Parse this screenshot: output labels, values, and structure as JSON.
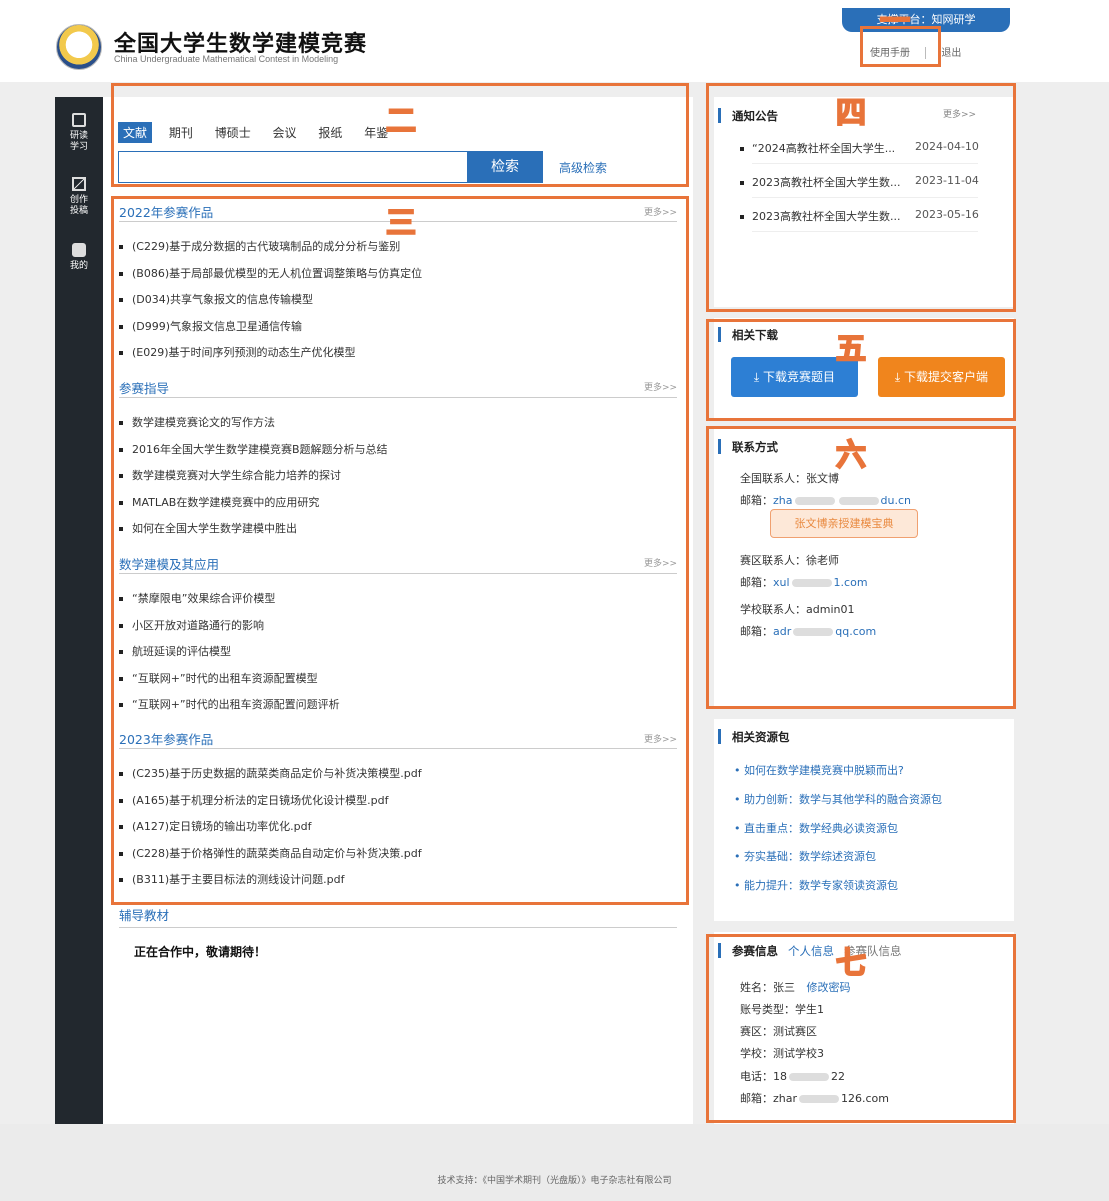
{
  "header": {
    "title": "全国大学生数学建模竞赛",
    "subtitle": "China Undergraduate Mathematical Contest in Modeling",
    "platform": "支撑平台：知网研学",
    "manual_link": "使用手册",
    "logout_link": "退出"
  },
  "sidebar": {
    "items": [
      {
        "label": "研读学习"
      },
      {
        "label": "创作投稿"
      },
      {
        "label": "我的"
      }
    ]
  },
  "search": {
    "tabs": [
      "文献",
      "期刊",
      "博硕士",
      "会议",
      "报纸",
      "年鉴"
    ],
    "button": "检索",
    "advanced": "高级检索"
  },
  "sections": [
    {
      "title": "2022年参赛作品",
      "more": "更多>>",
      "items": [
        "(C229)基于成分数据的古代玻璃制品的成分分析与鉴别",
        "(B086)基于局部最优模型的无人机位置调整策略与仿真定位",
        "(D034)共享气象报文的信息传输模型",
        "(D999)气象报文信息卫星通信传输",
        "(E029)基于时间序列预测的动态生产优化模型"
      ]
    },
    {
      "title": "参赛指导",
      "more": "更多>>",
      "items": [
        "数学建模竞赛论文的写作方法",
        "2016年全国大学生数学建模竞赛B题解题分析与总结",
        "数学建模竞赛对大学生综合能力培养的探讨",
        "MATLAB在数学建模竞赛中的应用研究",
        "如何在全国大学生数学建模中胜出"
      ]
    },
    {
      "title": "数学建模及其应用",
      "more": "更多>>",
      "items": [
        "“禁摩限电”效果综合评价模型",
        "小区开放对道路通行的影响",
        "航班延误的评估模型",
        "“互联网+”时代的出租车资源配置模型",
        "“互联网+”时代的出租车资源配置问题评析"
      ]
    },
    {
      "title": "2023年参赛作品",
      "more": "更多>>",
      "items": [
        "(C235)基于历史数据的蔬菜类商品定价与补货决策模型.pdf",
        "(A165)基于机理分析法的定日镜场优化设计模型.pdf",
        "(A127)定日镜场的输出功率优化.pdf",
        "(C228)基于价格弹性的蔬菜类商品自动定价与补货决策.pdf",
        "(B311)基于主要目标法的测线设计问题.pdf"
      ]
    },
    {
      "title": "辅导教材",
      "items": []
    }
  ],
  "cooperation": "正在合作中，敬请期待！",
  "notices": {
    "title": "通知公告",
    "more": "更多>>",
    "items": [
      {
        "text": "“2024高教社杯全国大学生...",
        "date": "2024-04-10"
      },
      {
        "text": "2023高教社杯全国大学生数...",
        "date": "2023-11-04"
      },
      {
        "text": "2023高教社杯全国大学生数...",
        "date": "2023-05-16"
      }
    ]
  },
  "downloads": {
    "title": "相关下载",
    "btn1": "下载竞赛题目",
    "btn2": "下载提交客户端"
  },
  "contacts": {
    "title": "联系方式",
    "national": "全国联系人：张文博",
    "email_label": "邮箱：",
    "national_email_a": "zha",
    "national_email_b": "du.cn",
    "treasure": "张文博亲授建模宝典",
    "region": "赛区联系人：徐老师",
    "region_email_a": "xul",
    "region_email_b": "1.com",
    "school": "学校联系人：admin01",
    "school_email_a": "adr",
    "school_email_b": "qq.com"
  },
  "resources": {
    "title": "相关资源包",
    "items": [
      "• 如何在数学建模竞赛中脱颖而出?",
      "• 助力创新：数学与其他学科的融合资源包",
      "• 直击重点：数学经典必读资源包",
      "• 夯实基础：数学综述资源包",
      "• 能力提升：数学专家领读资源包"
    ]
  },
  "info": {
    "title": "参赛信息",
    "tab1": "个人信息",
    "tab2": "参赛队信息",
    "name": "姓名：张三",
    "change_pwd": "修改密码",
    "account_type": "账号类型：学生1",
    "region": "赛区：测试赛区",
    "school": "学校：测试学校3",
    "phone_a": "电话：18",
    "phone_b": "22",
    "email_a": "邮箱：zhar",
    "email_b": "126.com"
  },
  "annotations": [
    "一",
    "二",
    "三",
    "四",
    "五",
    "六",
    "七"
  ],
  "footer": "技术支持：《中国学术期刊（光盘版）》电子杂志社有限公司",
  "colors": {
    "accent": "#2a6fb8",
    "orange": "#e8743a",
    "sidebar": "#22282e"
  }
}
